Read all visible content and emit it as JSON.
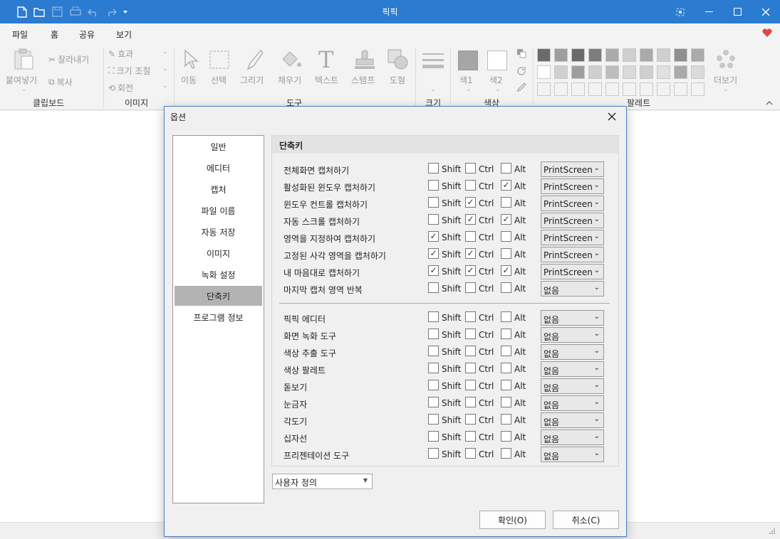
{
  "app": {
    "title": "픽픽"
  },
  "menu": [
    "파일",
    "홈",
    "공유",
    "보기"
  ],
  "ribbon": {
    "clipboard": {
      "paste": "붙여넣기",
      "cut": "잘라내기",
      "copy": "복사",
      "label": "클립보드"
    },
    "image": {
      "effect": "효과",
      "resize": "크기 조절",
      "rotate": "회전",
      "label": "이미지"
    },
    "tools": {
      "move": "이동",
      "select": "선택",
      "draw": "그리기",
      "fill": "채우기",
      "text": "텍스트",
      "stamp": "스탬프",
      "shape": "도형",
      "label": "도구"
    },
    "size": {
      "label": "크기"
    },
    "color": {
      "color1": "색1",
      "color2": "색2",
      "label": "색상"
    },
    "palette": {
      "more": "더보기",
      "label": "팔레트"
    }
  },
  "dialog": {
    "title": "옵션",
    "nav": [
      "일반",
      "에디터",
      "캡처",
      "파일 이름",
      "자동 저장",
      "이미지",
      "녹화 설정",
      "단축키",
      "프로그램 정보"
    ],
    "selected_nav": "단축키",
    "panel_title": "단축키",
    "mod_labels": {
      "shift": "Shift",
      "ctrl": "Ctrl",
      "alt": "Alt"
    },
    "shortcuts": [
      {
        "label": "전체화면 캡처하기",
        "shift": false,
        "ctrl": false,
        "alt": false,
        "key": "PrintScreen"
      },
      {
        "label": "활성화된 윈도우 캡처하기",
        "shift": false,
        "ctrl": false,
        "alt": true,
        "key": "PrintScreen"
      },
      {
        "label": "윈도우 컨트롤 캡처하기",
        "shift": false,
        "ctrl": true,
        "alt": false,
        "key": "PrintScreen"
      },
      {
        "label": "자동 스크롤 캡처하기",
        "shift": false,
        "ctrl": true,
        "alt": true,
        "key": "PrintScreen"
      },
      {
        "label": "영역을 지정하여 캡처하기",
        "shift": true,
        "ctrl": false,
        "alt": false,
        "key": "PrintScreen"
      },
      {
        "label": "고정된 사각 영역을 캡처하기",
        "shift": true,
        "ctrl": true,
        "alt": false,
        "key": "PrintScreen"
      },
      {
        "label": "내 마음대로 캡처하기",
        "shift": true,
        "ctrl": true,
        "alt": true,
        "key": "PrintScreen"
      },
      {
        "label": "마지막 캡처 영역 반복",
        "shift": false,
        "ctrl": false,
        "alt": false,
        "key": "없음"
      }
    ],
    "tools": [
      {
        "label": "픽픽 에디터",
        "shift": false,
        "ctrl": false,
        "alt": false,
        "key": "없음"
      },
      {
        "label": "화면 녹화 도구",
        "shift": false,
        "ctrl": false,
        "alt": false,
        "key": "없음"
      },
      {
        "label": "색상 추출 도구",
        "shift": false,
        "ctrl": false,
        "alt": false,
        "key": "없음"
      },
      {
        "label": "색상 팔레트",
        "shift": false,
        "ctrl": false,
        "alt": false,
        "key": "없음"
      },
      {
        "label": "돋보기",
        "shift": false,
        "ctrl": false,
        "alt": false,
        "key": "없음"
      },
      {
        "label": "눈금자",
        "shift": false,
        "ctrl": false,
        "alt": false,
        "key": "없음"
      },
      {
        "label": "각도기",
        "shift": false,
        "ctrl": false,
        "alt": false,
        "key": "없음"
      },
      {
        "label": "십자선",
        "shift": false,
        "ctrl": false,
        "alt": false,
        "key": "없음"
      },
      {
        "label": "프리젠테이션 도구",
        "shift": false,
        "ctrl": false,
        "alt": false,
        "key": "없음"
      }
    ],
    "preset": "사용자 정의",
    "ok": "확인(O)",
    "cancel": "취소(C)"
  },
  "colors": {
    "titlebar": "#2b7bd0",
    "accent": "#2b7bd0",
    "heart": "#e0474c"
  }
}
